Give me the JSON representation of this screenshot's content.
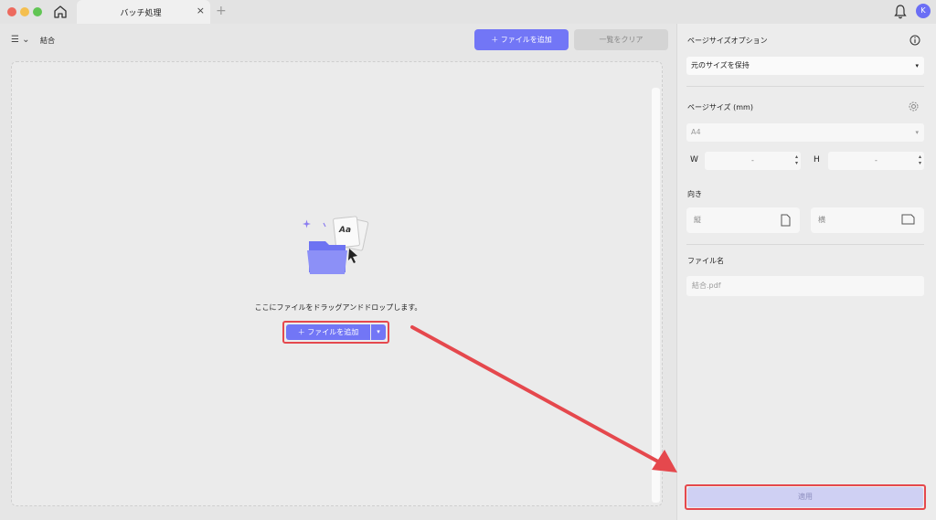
{
  "titlebar": {
    "tab_title": "バッチ処理",
    "tab_close": "×",
    "tab_add": "+",
    "avatar_initial": "K"
  },
  "toolbar": {
    "menu_glyph": "☰ ⌄",
    "mode_label": "結合",
    "add_files_label": "＋  ファイルを追加",
    "clear_list_label": "一覧をクリア"
  },
  "drop_zone": {
    "instruction": "ここにファイルをドラッグアンドドロップします。",
    "add_files_label": "＋  ファイルを追加",
    "dropdown_caret": "▾"
  },
  "panel": {
    "page_size_options_title": "ページサイズオプション",
    "page_size_option_value": "元のサイズを保持",
    "page_size_title": "ページサイズ (mm)",
    "page_size_value": "A4",
    "width_label": "W",
    "width_value": "-",
    "height_label": "H",
    "height_value": "-",
    "orientation_title": "向き",
    "portrait_label": "縦",
    "landscape_label": "横",
    "filename_title": "ファイル名",
    "filename_placeholder": "結合.pdf",
    "apply_label": "適用"
  },
  "colors": {
    "accent": "#7276f6",
    "highlight": "#e5484d",
    "apply_disabled": "#cfd0f3"
  },
  "icons": [
    "home-icon",
    "bell-icon",
    "menu-icon",
    "info-icon",
    "gear-icon",
    "portrait-page-icon",
    "landscape-page-icon",
    "folder-illustration"
  ]
}
